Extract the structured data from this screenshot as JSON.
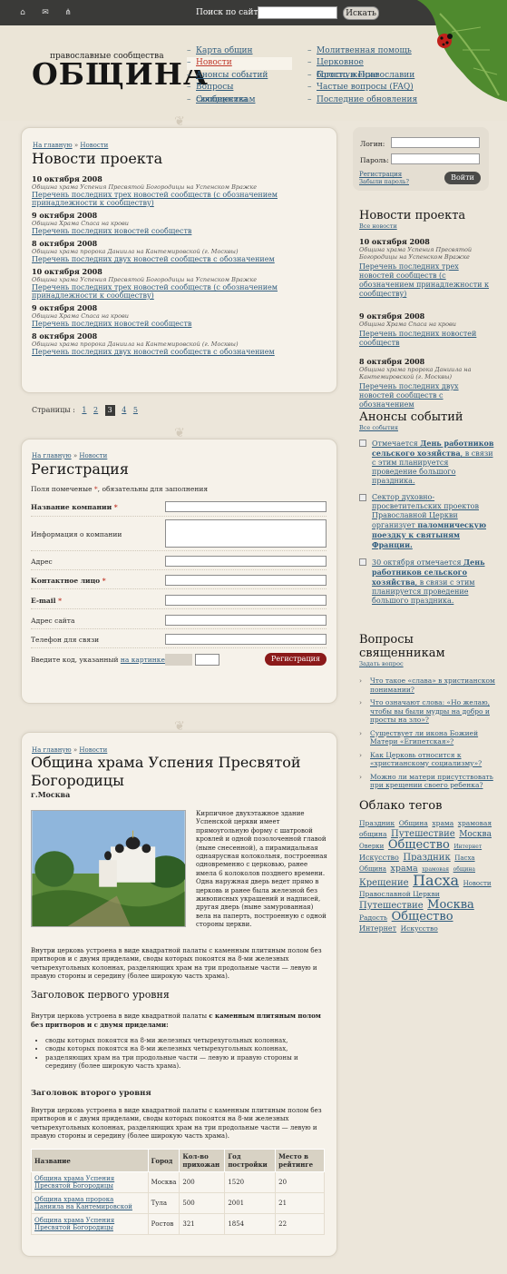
{
  "topbar": {
    "search_label": "Поиск по сайту",
    "search_button": "Искать",
    "icons": [
      "home-icon",
      "mail-icon",
      "sitemap-icon"
    ]
  },
  "logo": {
    "small": "православные сообщества",
    "big": "ОБЩИНА"
  },
  "nav": {
    "col1": [
      "Карта общин",
      "Новости",
      "Анонсы событий",
      "Вопросы священникам",
      "Сообщества"
    ],
    "col2": [
      "Молитвенная помощь",
      "Церковное богослужение",
      "Просто о Православии",
      "Частые вопросы (FAQ)",
      "Последние обновления"
    ],
    "active": "Новости"
  },
  "breadcrumb": {
    "home": "На главную",
    "sep": "»",
    "news": "Новости"
  },
  "news": {
    "title": "Новости проекта",
    "items": [
      {
        "date": "10 октября 2008",
        "source": "Община храма Успения Пресвятой Богородицы на Успенском Вражке",
        "link": "Перечень последних трех новостей сообществ (с обозначением принадлежности к сообществу)"
      },
      {
        "date": "9 октября 2008",
        "source": "Община Храма Спаса на крови",
        "link": "Перечень последних новостей сообществ"
      },
      {
        "date": "8 октября 2008",
        "source": "Община храма пророка Даниила на Кантемировской (г. Москвы)",
        "link": "Перечень последних двух новостей сообществ с обозначением"
      },
      {
        "date": "10 октября 2008",
        "source": "Община храма Успения Пресвятой Богородицы на Успенском Вражке",
        "link": "Перечень последних трех новостей сообществ (с обозначением принадлежности к сообществу)"
      },
      {
        "date": "9 октября 2008",
        "source": "Община Храма Спаса на крови",
        "link": "Перечень последних новостей сообществ"
      },
      {
        "date": "8 октября 2008",
        "source": "Община храма пророка Даниила на Кантемировской (г. Москвы)",
        "link": "Перечень последних двух новостей сообществ с обозначением"
      }
    ]
  },
  "pager": {
    "label": "Страницы :",
    "pages": [
      "1",
      "2",
      "3",
      "4",
      "5"
    ],
    "current": "3"
  },
  "registration": {
    "title": "Регистрация",
    "note_pre": "Поля помеченые ",
    "note_star": "*",
    "note_post": ", обязательны для заполнения",
    "fields": {
      "company": "Название компании",
      "info": "Информация о компании",
      "address": "Адрес",
      "contact": "Контактное лицо",
      "email": "E-mail",
      "site": "Адрес сайта",
      "phone": "Телефон для связи"
    },
    "captcha_pre": "Введите код, указанный ",
    "captcha_link": "на картинке",
    "submit": "Регистрация"
  },
  "article": {
    "title": "Община храма Успения Пресвятой Богородицы",
    "city": "г.Москва",
    "intro": "Кирпичное двухэтажное здание Успенской церкви имеет прямоугольную форму с шатровой кровлей и одной позолоченной главой (ныне снесенной), а пирамидальная однаярусная колокольня, построенная одновременно с церковью, ранее имела 6 колоколов позднего времени. Одна наружная дверь ведет прямо в церковь и ранее была железной без живописных украшений и надписей, другая дверь (ныне замурованная) вела на паперть, построенную с одной стороны церкви.",
    "para1": "Внутри церковь устроена в виде квадратной палаты с каменным плитяным полом без притворов и с двумя приделами, своды которых покоятся на 8-ми железных четырехугольных колоннах, разделяющих храм на три продольные части — левую и правую стороны и середину (более широкую часть храма).",
    "h2": "Заголовок первого уровня",
    "para2_pre": "Внутри церковь устроена в виде квадратной палаты ",
    "para2_bold": "с каменным плитяным полом без притворов и с двумя приделами:",
    "bullets": [
      "своды которых покоятся на 8-ми железных четырехугольных колоннах,",
      "своды которых покоятся на 8-ми железных четырехугольных колоннах,",
      "разделяющих храм на три продольные части — левую и правую стороны и середину (более широкую часть храма)."
    ],
    "h3": "Заголовок второго уровня",
    "para3": "Внутри церковь устроена в виде квадратной палаты с каменным плитяным полом без притворов и с двумя приделами, своды которых покоятся на 8-ми железных четырехугольных колоннах, разделяющих храм на три продольные части — левую и правую стороны и середину (более широкую часть храма).",
    "table": {
      "headers": [
        "Название",
        "Город",
        "Кол-во прихожан",
        "Год постройки",
        "Место в рейтинге"
      ],
      "rows": [
        [
          "Община храма Успения Пресвятой Богородицы",
          "Москва",
          "200",
          "1520",
          "20"
        ],
        [
          "Община храма пророка Даниила на Кантемировской",
          "Тула",
          "500",
          "2001",
          "21"
        ],
        [
          "Община храма Успения Пресвятой Богородицы",
          "Ростов",
          "321",
          "1854",
          "22"
        ]
      ]
    }
  },
  "login": {
    "login_label": "Логин:",
    "password_label": "Пароль:",
    "register": "Регистрация",
    "forgot": "Забыли пароль?",
    "submit": "Войти"
  },
  "side_news": {
    "title": "Новости проекта",
    "all": "Все новости",
    "items": [
      {
        "date": "10 октября 2008",
        "source": "Община храма Успения Пресвятой Богородицы на Успенском Вражке",
        "link": "Перечень последних трех новостей сообществ (с обозначением принадлежности к сообществу)"
      },
      {
        "date": "9 октября 2008",
        "source": "Община Храма Спаса на крови",
        "link": "Перечень последних новостей сообществ"
      },
      {
        "date": "8 октября 2008",
        "source": "Община храма пророка Даниила на Кантемировской (г. Москвы)",
        "link": "Перечень последних двух новостей сообществ с обозначением"
      }
    ]
  },
  "events": {
    "title": "Анонсы событий",
    "all": "Все события",
    "items": [
      {
        "pre": "Отмечается ",
        "bold": "День работников сельского хозяйства",
        "post": ", в связи с этим планируется проведение большого праздника."
      },
      {
        "pre": "Сектор духовно-просветительских проектов Православной Церкви организует ",
        "bold": "паломническую поездку к святыням Франции.",
        "post": ""
      },
      {
        "pre": "30 октября отмечается ",
        "bold": "День работников сельского хозяйства",
        "post": ", в связи с этим планируется проведение большого праздника."
      }
    ]
  },
  "questions": {
    "title": "Вопросы священникам",
    "ask": "Задать вопрос",
    "items": [
      "Что такое «слава» в христианском понимании?",
      "Что означают слова: «Но желаю, чтобы вы были мудры на добро и просты на зло»?",
      "Существует ли икона Божией Матери «Египетская»?",
      "Как Церковь относится к «христианскому социализму»?",
      "Можно ли матери присутствовать при крещении своего ребенка?"
    ]
  },
  "tags": {
    "title": "Облако тегов",
    "items": [
      {
        "t": "Праздник",
        "s": 7.5
      },
      {
        "t": "Община",
        "s": 7.5
      },
      {
        "t": "храма",
        "s": 7.5
      },
      {
        "t": "храмовая",
        "s": 7.5
      },
      {
        "t": "община",
        "s": 7.5
      },
      {
        "t": "Путешествие",
        "s": 10
      },
      {
        "t": "Москва",
        "s": 9
      },
      {
        "t": "Оверки",
        "s": 7
      },
      {
        "t": "Общество",
        "s": 13
      },
      {
        "t": "Интернет",
        "s": 6
      },
      {
        "t": "Искусство",
        "s": 8
      },
      {
        "t": "Праздник",
        "s": 10
      },
      {
        "t": "Пасха",
        "s": 7
      },
      {
        "t": "Община",
        "s": 7
      },
      {
        "t": "храма",
        "s": 9.5
      },
      {
        "t": "храмовая",
        "s": 6
      },
      {
        "t": "община",
        "s": 6
      },
      {
        "t": "Крещение",
        "s": 10
      },
      {
        "t": "Пасха",
        "s": 16
      },
      {
        "t": "Новости",
        "s": 7
      },
      {
        "t": "Православной Церкви",
        "s": 7.5
      },
      {
        "t": "Путешествие",
        "s": 10
      },
      {
        "t": "Москва",
        "s": 13
      },
      {
        "t": "Радость",
        "s": 7.5
      },
      {
        "t": "Общество",
        "s": 13
      },
      {
        "t": "Интернет",
        "s": 8
      },
      {
        "t": "Искусство",
        "s": 7.5
      }
    ]
  },
  "colors": {
    "accent": "#2f5c7e",
    "active": "#c0392b",
    "button": "#8b1a1a",
    "topbar": "#3a3a38"
  }
}
